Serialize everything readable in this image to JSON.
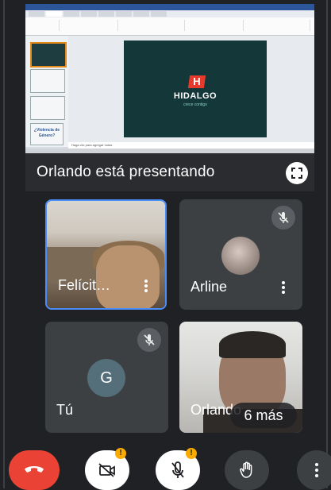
{
  "presentation": {
    "presenting_text": "Orlando está presentando",
    "slide": {
      "logo_letter": "H",
      "brand": "HIDALGO",
      "brand_sub": "crece contigo"
    },
    "notes_placeholder": "Haga clic para agregar notas",
    "thumbnail_text": "¿Violencia de Género?"
  },
  "participants": [
    {
      "name": "Felícit…",
      "muted": false,
      "active_speaker": true
    },
    {
      "name": "Arline",
      "muted": true
    },
    {
      "name": "Tú",
      "avatar_letter": "G",
      "muted": true
    },
    {
      "name": "Orlando",
      "muted": false
    }
  ],
  "more_participants": "6 más",
  "controls": {
    "camera_warning": "!",
    "mic_warning": "!"
  },
  "colors": {
    "background": "#202124",
    "tile": "#3c4043",
    "end_call": "#ea4335",
    "active_border": "#4a8df8",
    "warning": "#f9ab00"
  },
  "icons": [
    "fullscreen-icon",
    "more-vert-icon",
    "mic-off-icon",
    "end-call-icon",
    "camera-off-icon",
    "raise-hand-icon"
  ]
}
